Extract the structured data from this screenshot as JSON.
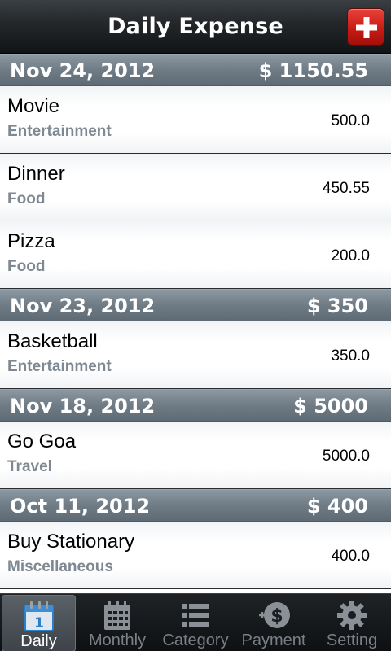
{
  "header": {
    "title": "Daily Expense",
    "add_icon": "plus-icon"
  },
  "sections": [
    {
      "date": "Nov 24, 2012",
      "total": "$ 1150.55",
      "items": [
        {
          "name": "Movie",
          "category": "Entertainment",
          "amount": "500.0"
        },
        {
          "name": "Dinner",
          "category": "Food",
          "amount": "450.55"
        },
        {
          "name": "Pizza",
          "category": "Food",
          "amount": "200.0"
        }
      ]
    },
    {
      "date": "Nov 23, 2012",
      "total": "$ 350",
      "items": [
        {
          "name": "Basketball",
          "category": "Entertainment",
          "amount": "350.0"
        }
      ]
    },
    {
      "date": "Nov 18, 2012",
      "total": "$ 5000",
      "items": [
        {
          "name": "Go Goa",
          "category": "Travel",
          "amount": "5000.0"
        }
      ]
    },
    {
      "date": "Oct 11, 2012",
      "total": "$ 400",
      "items": [
        {
          "name": "Buy Stationary",
          "category": "Miscellaneous",
          "amount": "400.0"
        }
      ]
    }
  ],
  "tabs": [
    {
      "label": "Daily",
      "icon": "calendar-day-icon",
      "active": true
    },
    {
      "label": "Monthly",
      "icon": "calendar-month-icon",
      "active": false
    },
    {
      "label": "Category",
      "icon": "list-icon",
      "active": false
    },
    {
      "label": "Payment",
      "icon": "dollar-coin-icon",
      "active": false
    },
    {
      "label": "Setting",
      "icon": "gear-icon",
      "active": false
    }
  ],
  "colors": {
    "header_bg": "#23272a",
    "section_bg": "#6f7c86",
    "add_button": "#c81c14",
    "category_text": "#7d8893",
    "active_tab_bg": "#4a5055"
  },
  "daily_icon_day": "1"
}
